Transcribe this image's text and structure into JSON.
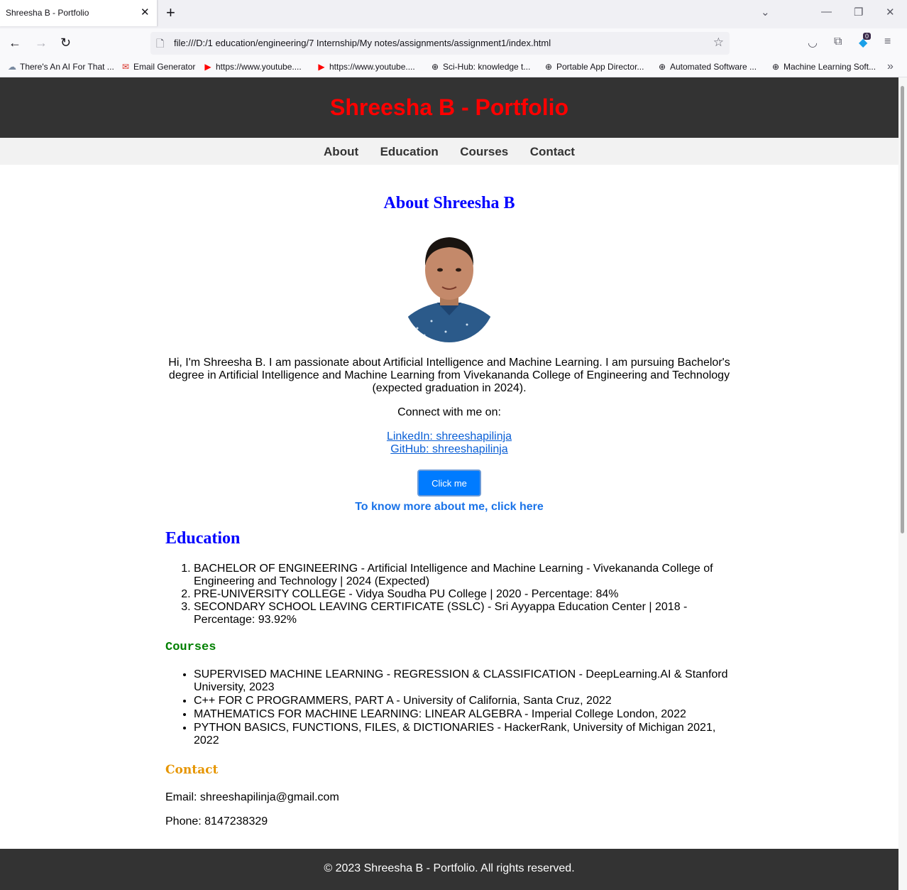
{
  "browser": {
    "tab_title": "Shreesha B - Portfolio",
    "url": "file:///D:/1 education/engineering/7 Internship/My notes/assignments/assignment1/index.html",
    "extension_badge": "0",
    "bookmarks": [
      {
        "label": "There's An AI For That ...",
        "icon": "cloud-icon"
      },
      {
        "label": "Email Generator",
        "icon": "gmail-icon"
      },
      {
        "label": "https://www.youtube....",
        "icon": "youtube-icon"
      },
      {
        "label": "https://www.youtube....",
        "icon": "youtube-icon"
      },
      {
        "label": "Sci-Hub: knowledge t...",
        "icon": "globe-icon"
      },
      {
        "label": "Portable App Director...",
        "icon": "globe-icon"
      },
      {
        "label": "Automated Software ...",
        "icon": "globe-icon"
      },
      {
        "label": "Machine Learning Soft...",
        "icon": "globe-icon"
      }
    ]
  },
  "site": {
    "title": "Shreesha B - Portfolio",
    "nav": [
      "About",
      "Education",
      "Courses",
      "Contact"
    ]
  },
  "about": {
    "heading": "About Shreesha B",
    "bio": "Hi, I'm Shreesha B. I am passionate about Artificial Intelligence and Machine Learning. I am pursuing Bachelor's degree in Artificial Intelligence and Machine Learning from Vivekananda College of Engineering and Technology (expected graduation in 2024).",
    "connect": "Connect with me on:",
    "linkedin": "LinkedIn: shreeshapilinja",
    "github": "GitHub: shreeshapilinja",
    "button": "Click me",
    "more": "To know more about me, click here"
  },
  "education": {
    "heading": "Education",
    "items": [
      "BACHELOR OF ENGINEERING - Artificial Intelligence and Machine Learning - Vivekananda College of Engineering and Technology | 2024 (Expected)",
      "PRE-UNIVERSITY COLLEGE - Vidya Soudha PU College | 2020 - Percentage: 84%",
      "SECONDARY SCHOOL LEAVING CERTIFICATE (SSLC) - Sri Ayyappa Education Center | 2018 - Percentage: 93.92%"
    ]
  },
  "courses": {
    "heading": "Courses",
    "items": [
      "SUPERVISED MACHINE LEARNING - REGRESSION & CLASSIFICATION - DeepLearning.AI & Stanford University, 2023",
      "C++ FOR C PROGRAMMERS, PART A - University of California, Santa Cruz, 2022",
      "MATHEMATICS FOR MACHINE LEARNING: LINEAR ALGEBRA - Imperial College London, 2022",
      "PYTHON BASICS, FUNCTIONS, FILES, & DICTIONARIES - HackerRank, University of Michigan 2021, 2022"
    ]
  },
  "contact": {
    "heading": "Contact",
    "email": "Email: shreeshapilinja@gmail.com",
    "phone": "Phone: 8147238329"
  },
  "footer": "© 2023 Shreesha B - Portfolio. All rights reserved."
}
